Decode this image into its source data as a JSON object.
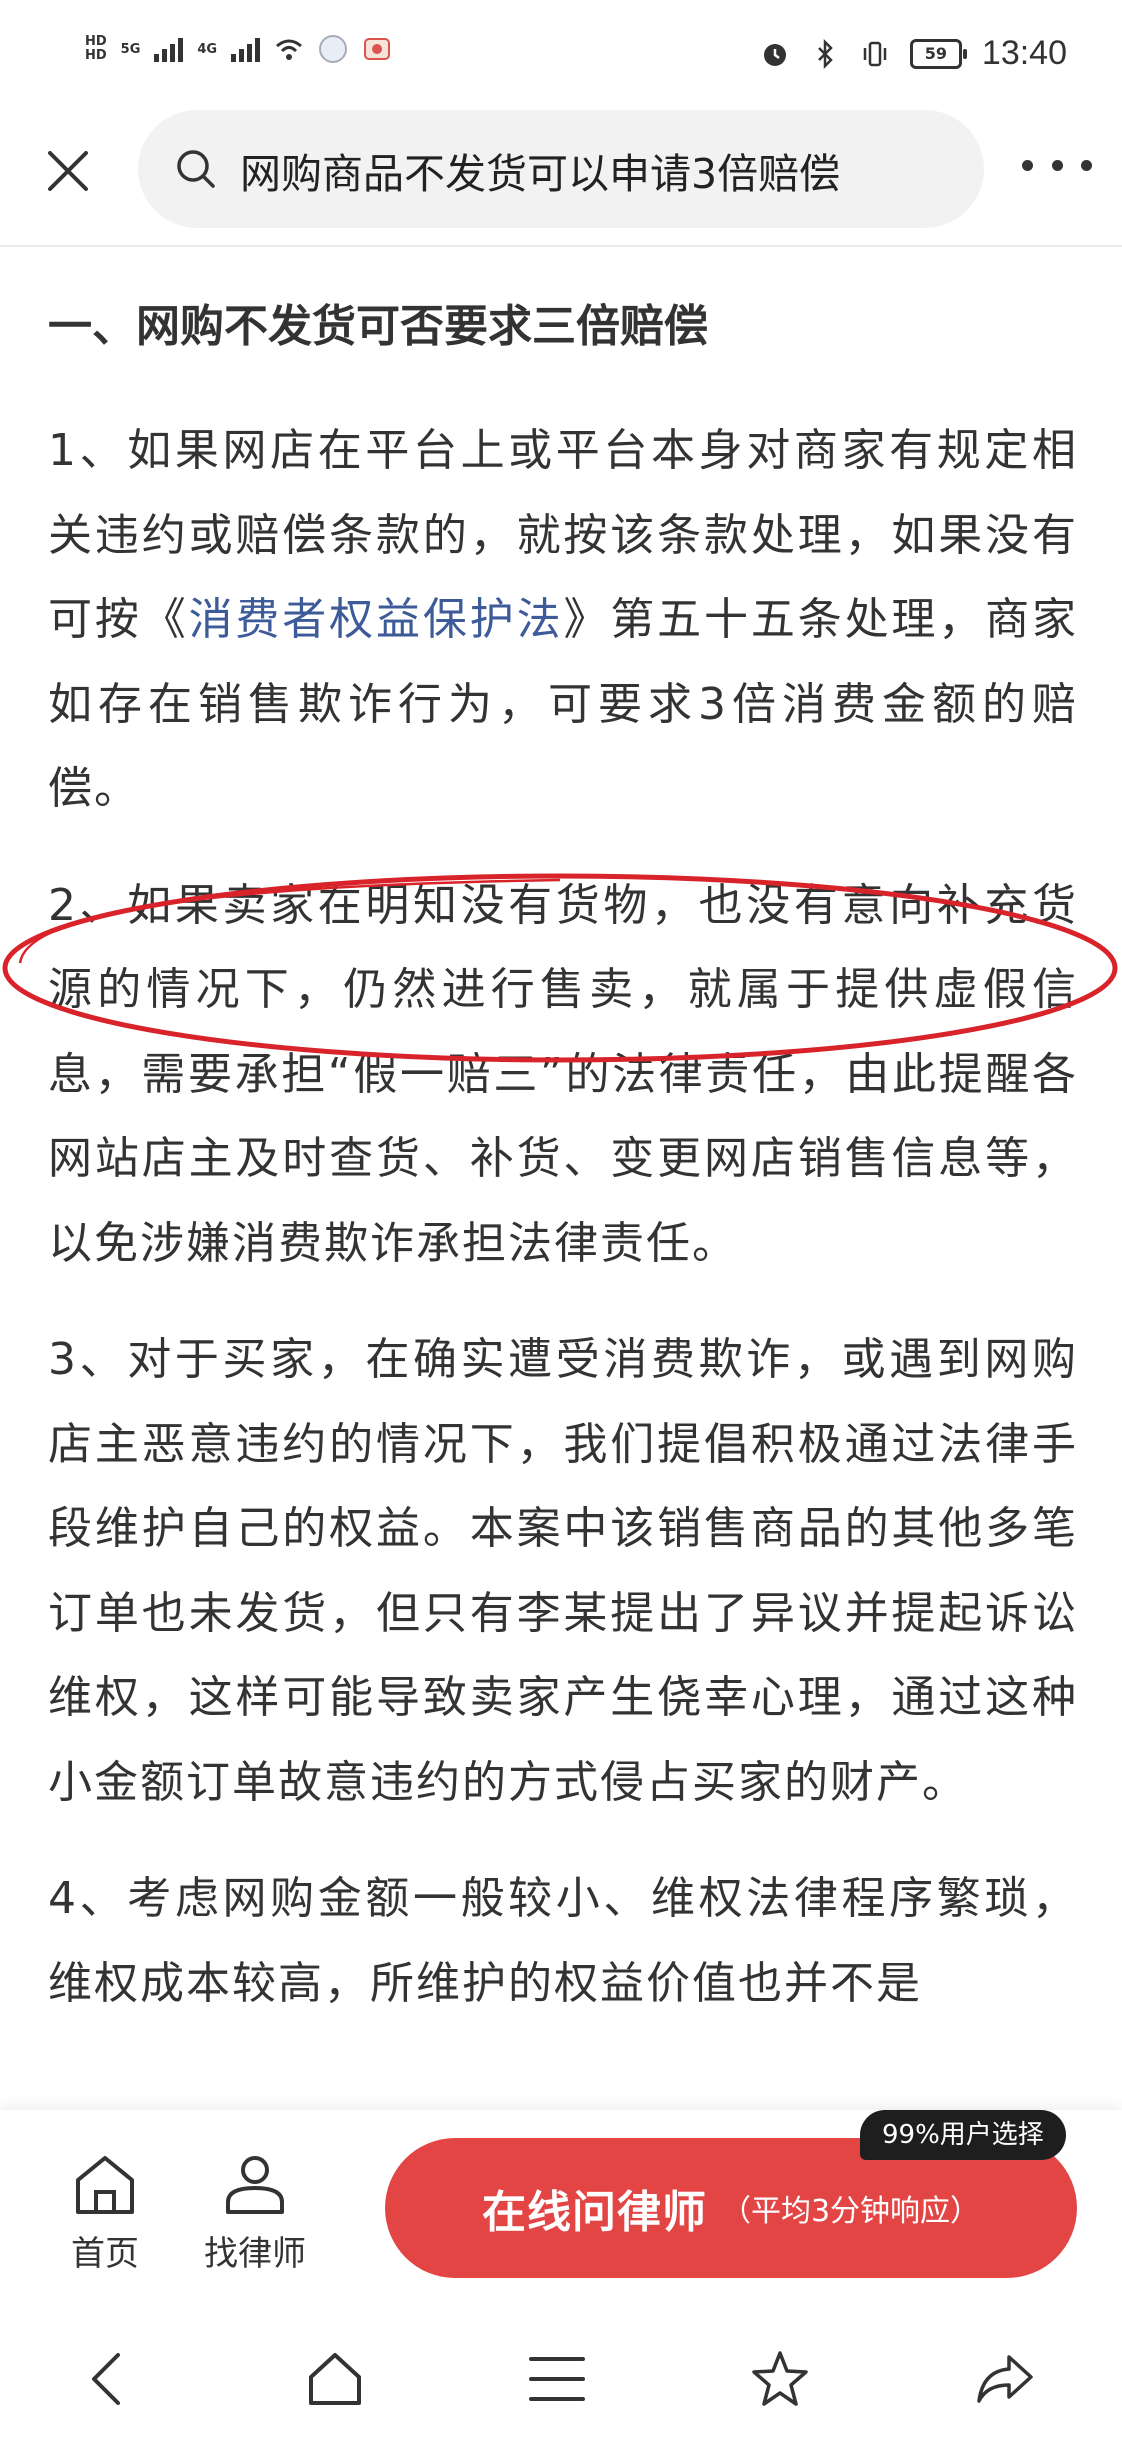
{
  "status_bar": {
    "hd1": "HD",
    "hd2": "HD",
    "net1": "5G",
    "net2": "4G",
    "battery": "59",
    "time": "13:40"
  },
  "search": {
    "query": "网购商品不发货可以申请3倍赔偿"
  },
  "article": {
    "heading": "一、网购不发货可否要求三倍赔偿",
    "p1_before": "1、如果网店在平台上或平台本身对商家有规定相关违约或赔偿条款的，就按该条款处理，如果没有可按《",
    "p1_link": "消费者权益保护法",
    "p1_after": "》第五十五条处理，商家如存在销售欺诈行为，可要求3倍消费金额的赔偿。",
    "p2": "2、如果卖家在明知没有货物，也没有意向补充货源的情况下，仍然进行售卖，就属于提供虚假信息，需要承担“假一赔三”的法律责任，由此提醒各网站店主及时查货、补货、变更网店销售信息等，以免涉嫌消费欺诈承担法律责任。",
    "p3": "3、对于买家，在确实遭受消费欺诈，或遇到网购店主恶意违约的情况下，我们提倡积极通过法律手段维护自己的权益。本案中该销售商品的其他多笔订单也未发货，但只有李某提出了异议并提起诉讼维权，这样可能导致卖家产生侥幸心理，通过这种小金额订单故意违约的方式侵占买家的财产。",
    "p4": "4、考虑网购金额一般较小、维权法律程序繁琐，维权成本较高，所维护的权益价值也并不是"
  },
  "bottom_bar": {
    "home_label": "首页",
    "lawyer_label": "找律师",
    "cta_main": "在线问律师",
    "cta_sub": "（平均3分钟响应）",
    "badge": "99%用户选择"
  },
  "colors": {
    "cta": "#e34545",
    "link": "#3d5a99",
    "annotation": "#d9232a"
  }
}
